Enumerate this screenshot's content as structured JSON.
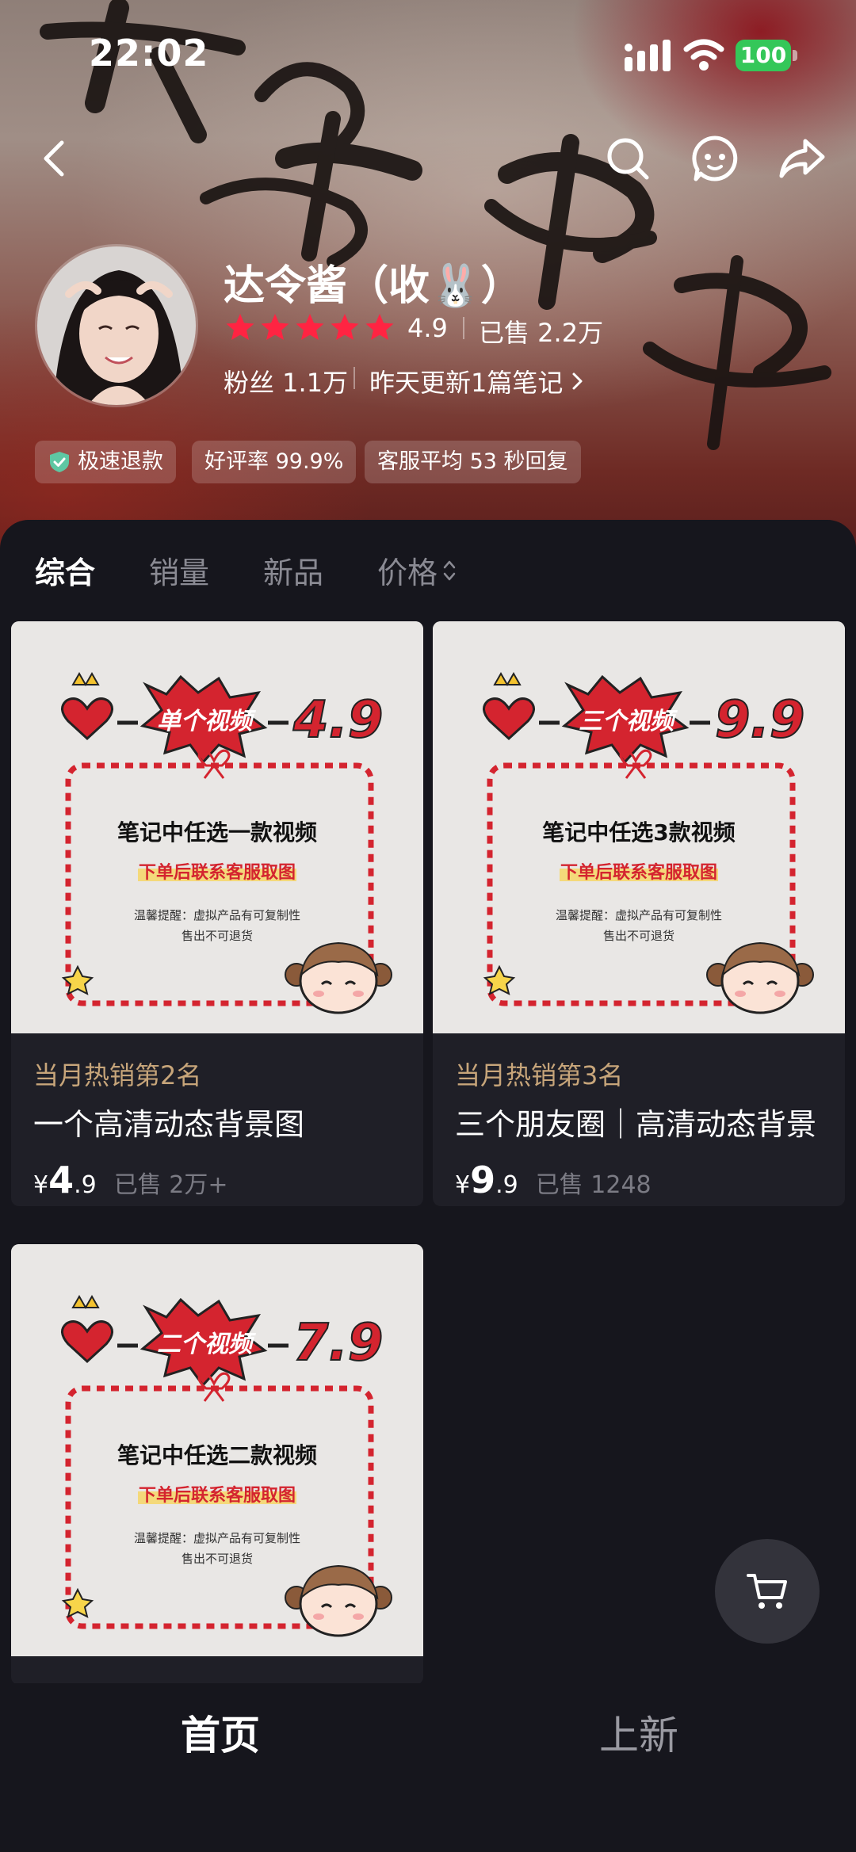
{
  "status_bar": {
    "time": "22:02",
    "battery": "100"
  },
  "shop": {
    "name": "达令酱（收🐰）",
    "rating": "4.9",
    "sold": "已售 2.2万",
    "fans": "粉丝 1.1万",
    "updated": "昨天更新1篇笔记",
    "stars": 5
  },
  "badges": [
    "极速退款",
    "好评率 99.9%",
    "客服平均 53 秒回复"
  ],
  "tabs": [
    "综合",
    "销量",
    "新品",
    "价格"
  ],
  "products": [
    {
      "rank": "当月热销第2名",
      "title": "一个高清动态背景图",
      "currency": "¥",
      "price_int": "4",
      "price_dec": ".9",
      "sold": "已售 2万+",
      "image": {
        "badge": "单个视频",
        "price": "4.9",
        "line1": "笔记中任选一款视频",
        "line2": "下单后联系客服取图",
        "note1": "温馨提醒：虚拟产品有可复制性",
        "note2": "售出不可退货"
      }
    },
    {
      "rank": "当月热销第3名",
      "title": "三个朋友圈｜高清动态背景",
      "currency": "¥",
      "price_int": "9",
      "price_dec": ".9",
      "sold": "已售 1248",
      "image": {
        "badge": "三个视频",
        "price": "9.9",
        "line1": "笔记中任选3款视频",
        "line2": "下单后联系客服取图",
        "note1": "温馨提醒：虚拟产品有可复制性",
        "note2": "售出不可退货"
      }
    },
    {
      "image": {
        "badge": "二个视频",
        "price": "7.9",
        "line1": "笔记中任选二款视频",
        "line2": "下单后联系客服取图",
        "note1": "温馨提醒：虚拟产品有可复制性",
        "note2": "售出不可退货"
      }
    }
  ],
  "bottom_nav": [
    "首页",
    "上新"
  ],
  "colors": {
    "star": "#ff2442",
    "rank": "#c7a57a",
    "accent_red": "#d4242f",
    "battery": "#34c759"
  },
  "icons": [
    "back-icon",
    "search-icon",
    "support-icon",
    "share-icon",
    "cart-icon",
    "shield-check-icon",
    "chevron-right-icon",
    "sort-icon"
  ]
}
